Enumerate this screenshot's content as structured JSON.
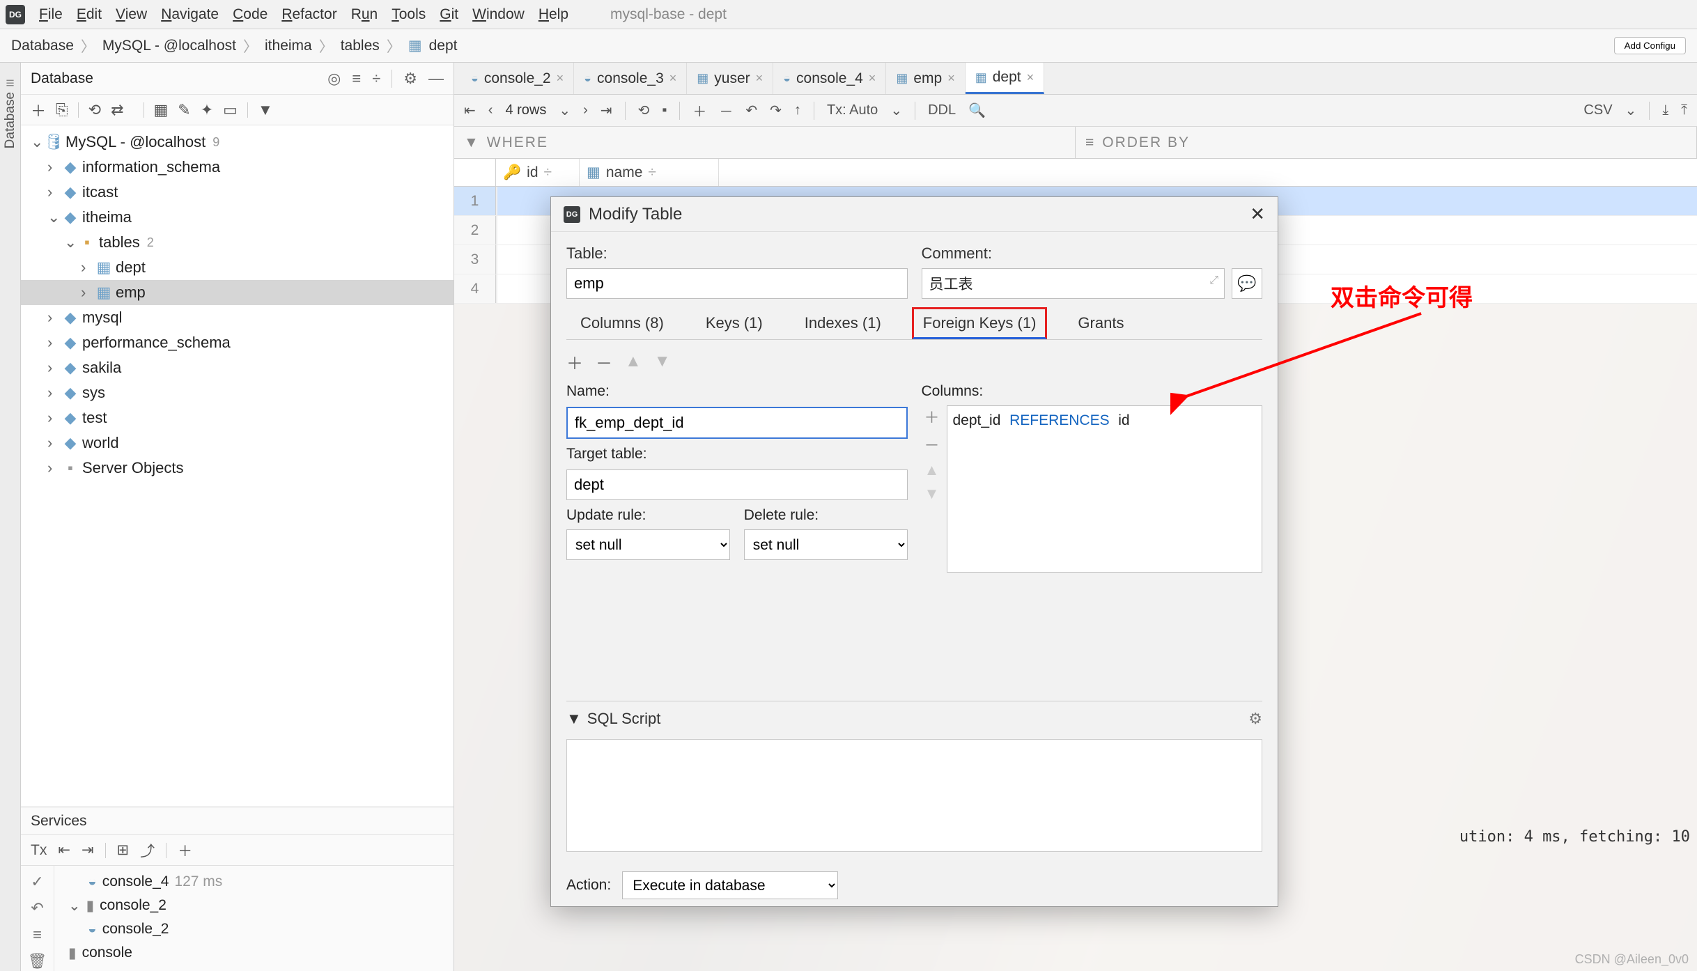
{
  "window_title": "mysql-base - dept",
  "menu": [
    "File",
    "Edit",
    "View",
    "Navigate",
    "Code",
    "Refactor",
    "Run",
    "Tools",
    "Git",
    "Window",
    "Help"
  ],
  "breadcrumbs": [
    "Database",
    "MySQL - @localhost",
    "itheima",
    "tables",
    "dept"
  ],
  "add_config_btn": "Add Configu",
  "sidebar_label": "Database",
  "db_panel_title": "Database",
  "tree": {
    "root": "MySQL - @localhost",
    "root_badge": "9",
    "schemas": [
      {
        "name": "information_schema"
      },
      {
        "name": "itcast"
      },
      {
        "name": "itheima",
        "expanded": true,
        "children": [
          {
            "name": "tables",
            "badge": "2",
            "expanded": true,
            "children": [
              {
                "name": "dept"
              },
              {
                "name": "emp",
                "selected": true
              }
            ]
          }
        ]
      },
      {
        "name": "mysql"
      },
      {
        "name": "performance_schema"
      },
      {
        "name": "sakila"
      },
      {
        "name": "sys"
      },
      {
        "name": "test"
      },
      {
        "name": "world"
      },
      {
        "name": "Server Objects"
      }
    ]
  },
  "tabs": [
    {
      "label": "console_2",
      "icon": "sql"
    },
    {
      "label": "console_3",
      "icon": "sql"
    },
    {
      "label": "yuser",
      "icon": "table"
    },
    {
      "label": "console_4",
      "icon": "sql"
    },
    {
      "label": "emp",
      "icon": "table"
    },
    {
      "label": "dept",
      "icon": "table",
      "active": true
    }
  ],
  "grid_toolbar": {
    "rows": "4 rows",
    "tx": "Tx: Auto",
    "ddl": "DDL",
    "csv": "CSV"
  },
  "filters": {
    "where": "WHERE",
    "orderby": "ORDER BY"
  },
  "grid": {
    "cols": [
      "id",
      "name"
    ],
    "rows": [
      1,
      2,
      3,
      4
    ]
  },
  "services": {
    "title": "Services",
    "tx_label": "Tx",
    "items": [
      {
        "label": "console_4",
        "meta": "127 ms",
        "icon": "sql",
        "indent": 1
      },
      {
        "label": "console_2",
        "icon": "db",
        "indent": 0,
        "arrow": true
      },
      {
        "label": "console_2",
        "icon": "sql",
        "indent": 1
      },
      {
        "label": "console",
        "icon": "db",
        "indent": 0
      }
    ]
  },
  "modal": {
    "title": "Modify Table",
    "table_label": "Table:",
    "table_val": "emp",
    "comment_label": "Comment:",
    "comment_val": "员工表",
    "tabs": [
      {
        "label": "Columns (8)"
      },
      {
        "label": "Keys (1)"
      },
      {
        "label": "Indexes (1)"
      },
      {
        "label": "Foreign Keys (1)",
        "active": true
      },
      {
        "label": "Grants"
      }
    ],
    "name_label": "Name:",
    "name_val": "fk_emp_dept_id",
    "target_label": "Target table:",
    "target_val": "dept",
    "update_label": "Update rule:",
    "update_val": "set null",
    "delete_label": "Delete rule:",
    "delete_val": "set null",
    "columns_label": "Columns:",
    "columns_expr": {
      "col": "dept_id",
      "kw": "REFERENCES",
      "ref": "id"
    },
    "sql_label": "SQL Script",
    "action_label": "Action:",
    "action_val": "Execute in database"
  },
  "annotation": "双击命令可得",
  "status_br": "ution: 4 ms, fetching: 10",
  "watermark": "CSDN @Aileen_0v0"
}
